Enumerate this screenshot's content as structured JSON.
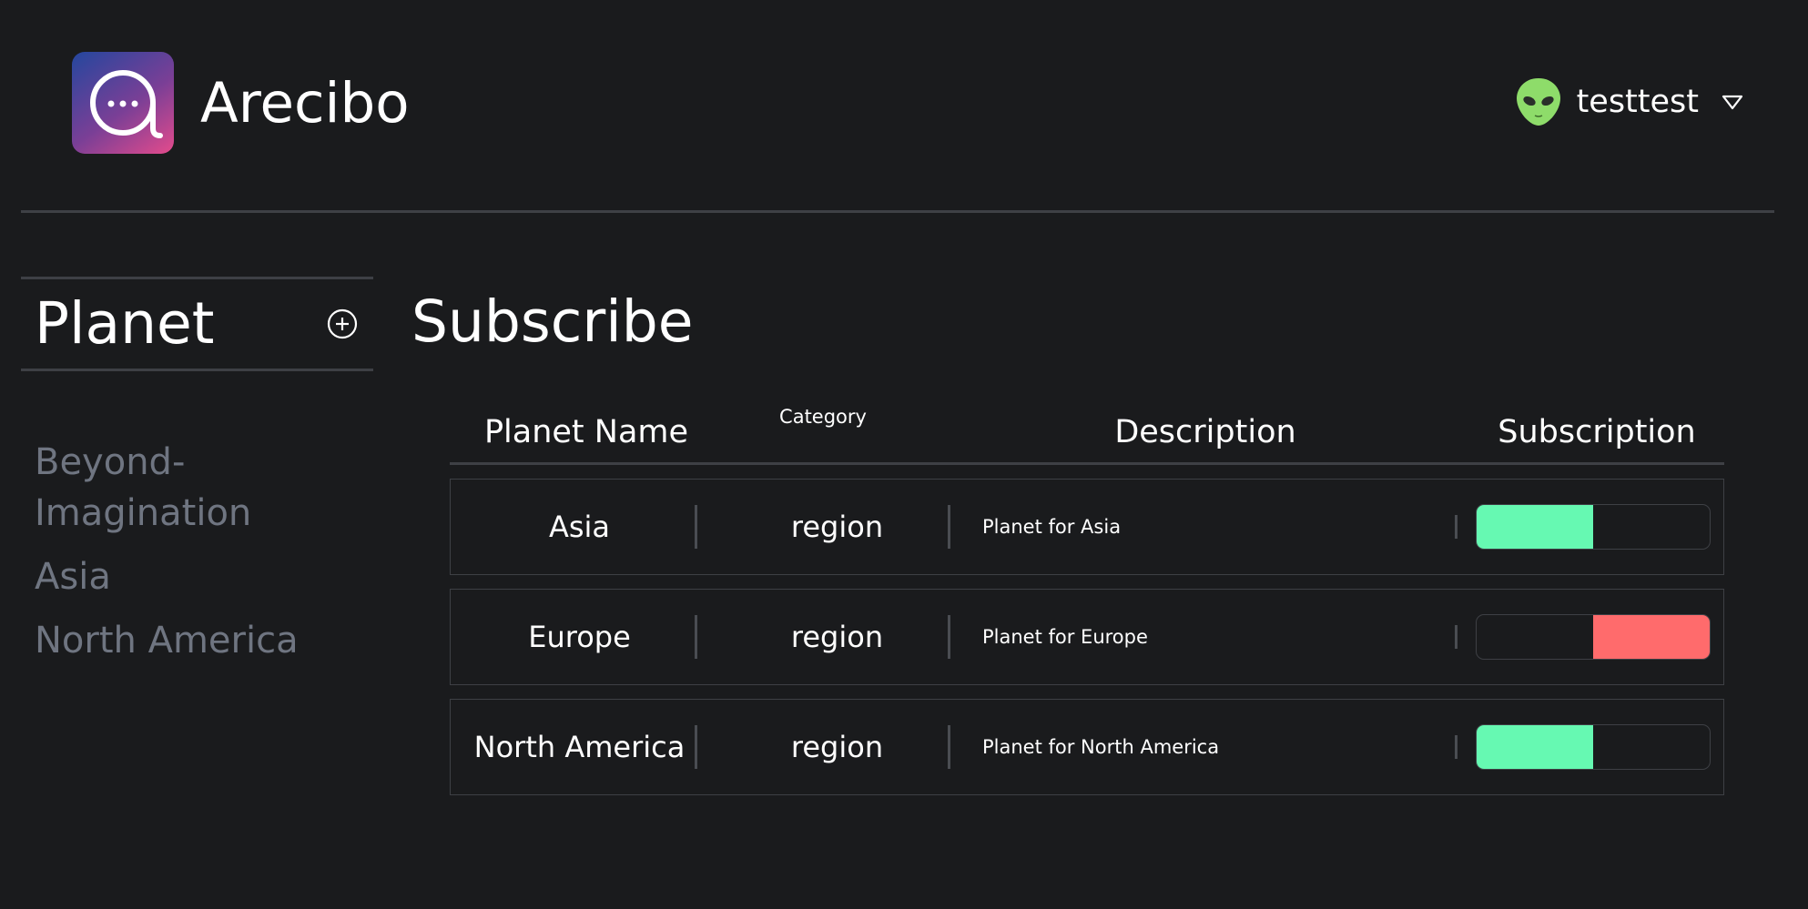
{
  "app": {
    "title": "Arecibo"
  },
  "user": {
    "name": "testtest",
    "avatar_icon": "alien-face-icon"
  },
  "sidebar": {
    "title": "Planet",
    "items": [
      {
        "label": "Beyond-\nImagination"
      },
      {
        "label": "Asia"
      },
      {
        "label": "North America"
      }
    ]
  },
  "main": {
    "title": "Subscribe",
    "columns": {
      "name": "Planet Name",
      "category": "Category",
      "description": "Description",
      "subscription": "Subscription"
    },
    "rows": [
      {
        "name": "Asia",
        "category": "region",
        "description": "Planet for Asia",
        "subscribed": true
      },
      {
        "name": "Europe",
        "category": "region",
        "description": "Planet for Europe",
        "subscribed": false
      },
      {
        "name": "North America",
        "category": "region",
        "description": "Planet for North America",
        "subscribed": true
      }
    ]
  },
  "colors": {
    "background": "#1a1b1d",
    "subscribed": "#66f9b2",
    "unsubscribed": "#ff6b6c",
    "muted_text": "#6f7581"
  }
}
